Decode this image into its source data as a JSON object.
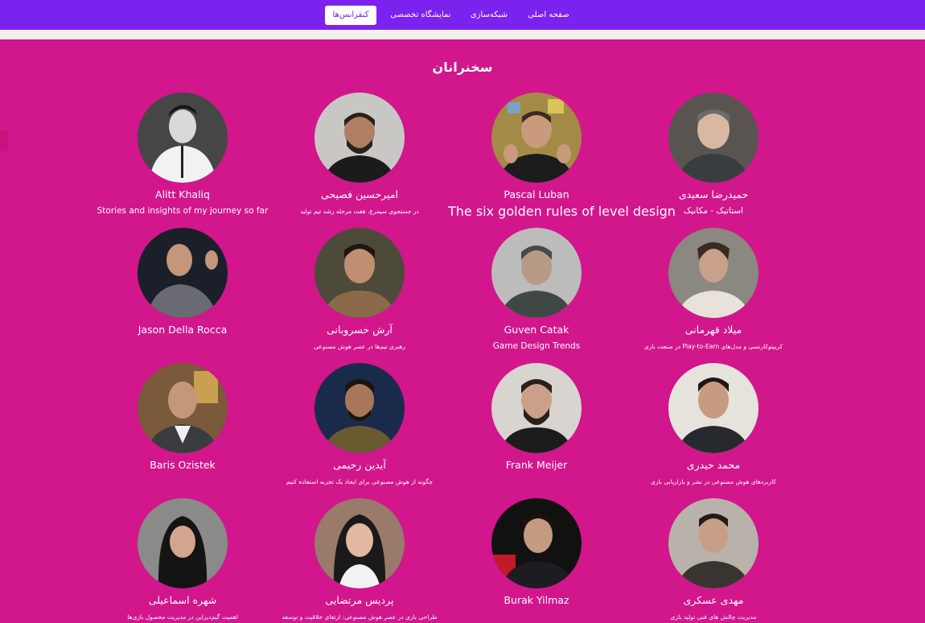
{
  "nav": {
    "items": [
      {
        "label": "صفحه اصلی"
      },
      {
        "label": "شبکه‌سازی"
      },
      {
        "label": "نمایشگاه تخصصی"
      },
      {
        "label": "کنفرانس‌ها",
        "active": true
      }
    ],
    "accent": "#7b22ee"
  },
  "section": {
    "title": "سخنرانان",
    "background": "#d2168c"
  },
  "speakers": [
    {
      "name": "Alitt Khaliq",
      "topic": "Stories and insights of my journey so far"
    },
    {
      "name": "امیرحسین فصیحی",
      "topic": "در جستجوی سیمرغ، هفت مرحله رشد تیم تولید"
    },
    {
      "name": "Pascal Luban",
      "topic": "The six golden rules of level design"
    },
    {
      "name": "حمیدرضا سعیدی",
      "topic": "استاتیک - مکانیک"
    },
    {
      "name": "Jason Della Rocca",
      "topic": ""
    },
    {
      "name": "آرش خسروبانی",
      "topic": "رهبری تیم‌ها در عصر هوش مصنوعی"
    },
    {
      "name": "Guven Catak",
      "topic": "Game Design Trends"
    },
    {
      "name": "میلاد قهرمانی",
      "topic": "کریپتوکارنسی و مدل‌های Play-to-Earn در صنعت بازی"
    },
    {
      "name": "Baris Ozistek",
      "topic": ""
    },
    {
      "name": "آیدین رحیمی",
      "topic": "چگونه از هوش مصنوعی برای ایجاد یک تجربه استفاده کنیم"
    },
    {
      "name": "Frank Meijer",
      "topic": ""
    },
    {
      "name": "محمد حیدری",
      "topic": "کاربردهای هوش مصنوعی در نشر و بازاریابی بازی"
    },
    {
      "name": "شهره اسماعیلی",
      "topic": "اهمیت گیم‌دیزاین در مدیریت محصول بازی‌ها"
    },
    {
      "name": "پردیس مرتضایی",
      "topic": "طراحی بازی در عصر هوش مصنوعی: ارتقای خلاقیت و توسعه"
    },
    {
      "name": "Burak Yilmaz",
      "topic": ""
    },
    {
      "name": "مهدی عسکری",
      "topic": "مدیریت چالش های فنی تولید بازی"
    }
  ]
}
